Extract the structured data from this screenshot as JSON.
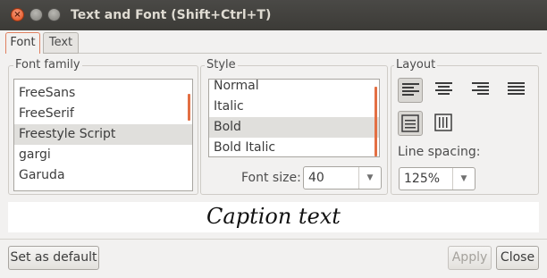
{
  "window": {
    "title": "Text and Font (Shift+Ctrl+T)",
    "close_glyph": "×"
  },
  "tabs": [
    {
      "label": "Font",
      "active": true
    },
    {
      "label": "Text",
      "active": false
    }
  ],
  "font_family": {
    "label": "Font family",
    "items": [
      "FreeSans",
      "FreeSerif",
      "Freestyle Script",
      "gargi",
      "Garuda"
    ],
    "selected": "Freestyle Script"
  },
  "style": {
    "label": "Style",
    "items": [
      "Normal",
      "Italic",
      "Bold",
      "Bold Italic"
    ],
    "selected": "Bold",
    "font_size_label": "Font size:",
    "font_size_value": "40"
  },
  "layout": {
    "label": "Layout",
    "align_icons": [
      "align-left-icon",
      "align-center-icon",
      "align-right-icon",
      "align-justify-icon"
    ],
    "selected_align": "align-left-icon",
    "mode_icons": [
      "text-horizontal-icon",
      "text-vertical-icon"
    ],
    "line_spacing_label": "Line spacing:",
    "line_spacing_value": "125%"
  },
  "preview": {
    "text": "Caption text"
  },
  "buttons": {
    "set_default": "Set as default",
    "apply": "Apply",
    "close": "Close"
  },
  "colors": {
    "accent": "#e36f43",
    "titlebar": "#3c3b37"
  }
}
